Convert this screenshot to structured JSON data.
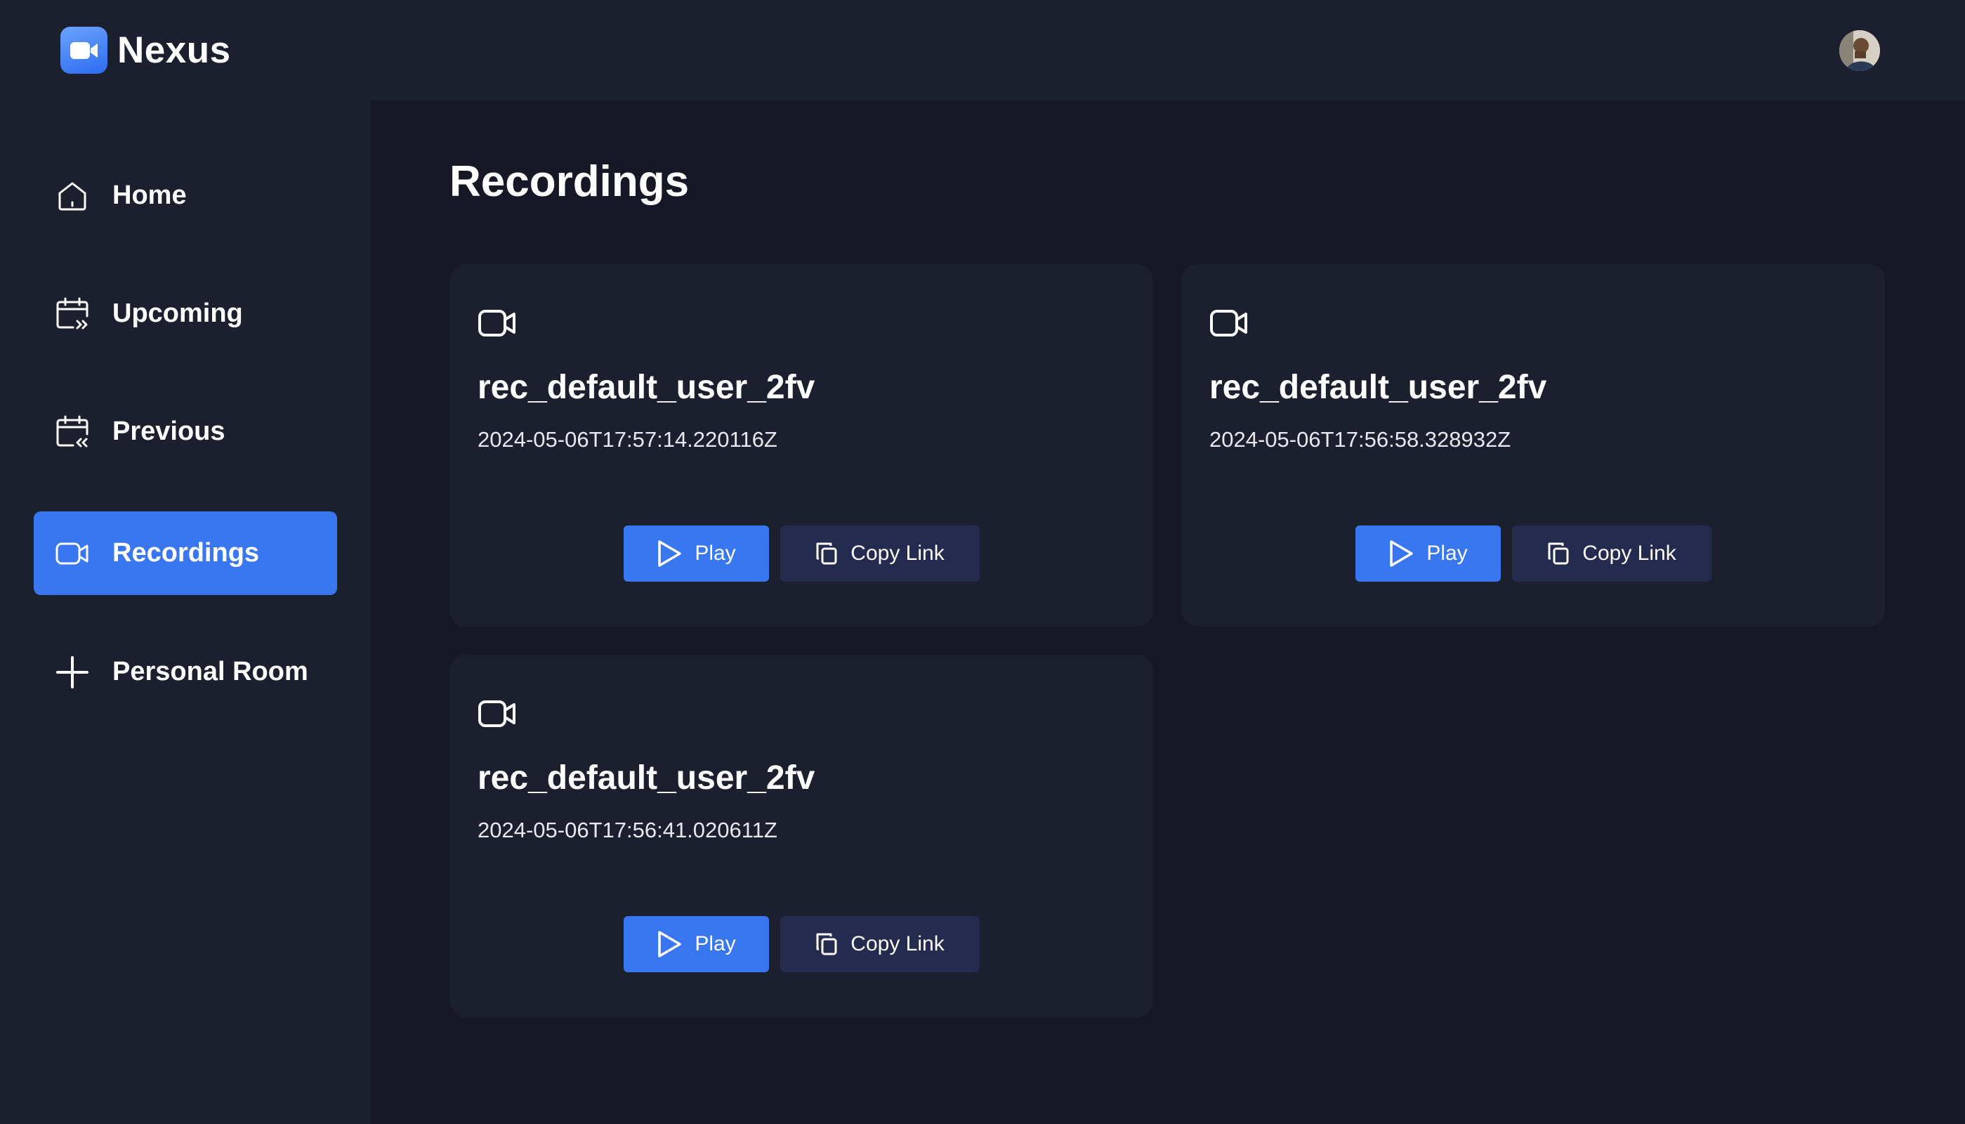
{
  "app": {
    "name": "Nexus",
    "logo_icon": "video-camera-icon",
    "brand_color": "#3877f0"
  },
  "sidebar": {
    "items": [
      {
        "label": "Home",
        "icon": "home-icon",
        "active": false
      },
      {
        "label": "Upcoming",
        "icon": "calendar-upcoming-icon",
        "active": false
      },
      {
        "label": "Previous",
        "icon": "calendar-previous-icon",
        "active": false
      },
      {
        "label": "Recordings",
        "icon": "video-icon",
        "active": true
      },
      {
        "label": "Personal Room",
        "icon": "plus-icon",
        "active": false
      }
    ]
  },
  "main": {
    "title": "Recordings",
    "recordings": [
      {
        "name": "rec_default_user_2fv",
        "date": "2024-05-06T17:57:14.220116Z",
        "play_label": "Play",
        "copy_label": "Copy Link"
      },
      {
        "name": "rec_default_user_2fv",
        "date": "2024-05-06T17:56:58.328932Z",
        "play_label": "Play",
        "copy_label": "Copy Link"
      },
      {
        "name": "rec_default_user_2fv",
        "date": "2024-05-06T17:56:41.020611Z",
        "play_label": "Play",
        "copy_label": "Copy Link"
      }
    ]
  },
  "colors": {
    "page_bg": "#161925",
    "panel_bg": "#1c1f2e",
    "accent": "#3877f0",
    "secondary_button": "#252a4f"
  }
}
